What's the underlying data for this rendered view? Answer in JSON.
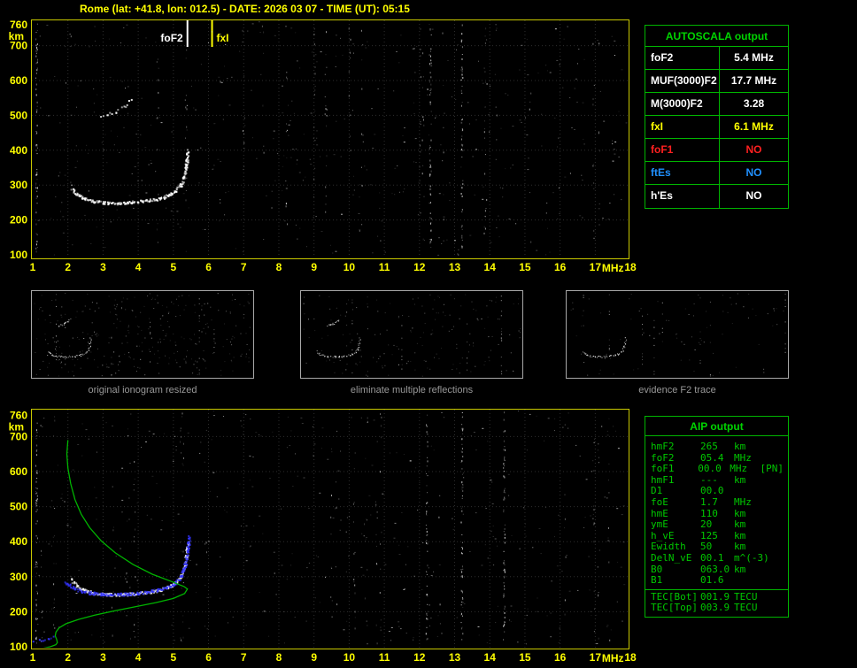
{
  "title": "Rome (lat: +41.8, lon: 012.5) - DATE: 2026 03 07 - TIME (UT): 05:15",
  "colors": {
    "background": "#000000",
    "title": "#ffff00",
    "plot_border": "#c8c800",
    "axis_label": "#ffff00",
    "grid": "#2e2e2e",
    "table_border": "#00b400",
    "aip_text": "#00c800",
    "caption": "#989898"
  },
  "autoscala": {
    "title": "AUTOSCALA output",
    "rows": [
      {
        "label": "foF2",
        "value": "5.4 MHz",
        "color": "#ffffff"
      },
      {
        "label": "MUF(3000)F2",
        "value": "17.7 MHz",
        "color": "#ffffff"
      },
      {
        "label": "M(3000)F2",
        "value": "3.28",
        "color": "#ffffff"
      },
      {
        "label": "fxI",
        "value": "6.1 MHz",
        "color": "#ffff00"
      },
      {
        "label": "foF1",
        "value": "NO",
        "color": "#ff2020"
      },
      {
        "label": "ftEs",
        "value": "NO",
        "color": "#2090ff"
      },
      {
        "label": "h'Es",
        "value": "NO",
        "color": "#ffffff"
      }
    ]
  },
  "thumbnails": [
    {
      "caption": "original ionogram resized"
    },
    {
      "caption": "eliminate multiple reflections"
    },
    {
      "caption": "evidence F2 trace"
    }
  ],
  "aip": {
    "title": "AIP output",
    "rows": [
      {
        "name": "hmF2",
        "value": "265",
        "unit": "km",
        "note": ""
      },
      {
        "name": "foF2",
        "value": "05.4",
        "unit": "MHz",
        "note": ""
      },
      {
        "name": "foF1",
        "value": "00.0",
        "unit": "MHz",
        "note": "[PN]"
      },
      {
        "name": "hmF1",
        "value": "---",
        "unit": "km",
        "note": ""
      },
      {
        "name": "D1",
        "value": "00.0",
        "unit": "",
        "note": ""
      },
      {
        "name": "foE",
        "value": "1.7",
        "unit": "MHz",
        "note": ""
      },
      {
        "name": "hmE",
        "value": "110",
        "unit": "km",
        "note": ""
      },
      {
        "name": "ymE",
        "value": "20",
        "unit": "km",
        "note": ""
      },
      {
        "name": "h_vE",
        "value": "125",
        "unit": "km",
        "note": ""
      },
      {
        "name": "Ewidth",
        "value": "50",
        "unit": "km",
        "note": ""
      },
      {
        "name": "DelN_vE",
        "value": "00.1",
        "unit": "m^(-3)",
        "note": ""
      },
      {
        "name": "B0",
        "value": "063.0",
        "unit": "km",
        "note": ""
      },
      {
        "name": "B1",
        "value": "01.6",
        "unit": "",
        "note": ""
      }
    ],
    "tec_rows": [
      {
        "name": "TEC[Bot]",
        "value": "001.9",
        "unit": "TECU"
      },
      {
        "name": "TEC[Top]",
        "value": "003.9",
        "unit": "TECU"
      }
    ]
  },
  "chart_data": [
    {
      "id": "top-ionogram",
      "type": "scatter",
      "title": "recorded ionogram with autoscaled characteristics",
      "xlabel": "MHz",
      "ylabel": "km",
      "xlim": [
        1,
        18
      ],
      "ylim": [
        90,
        775
      ],
      "xticks": [
        1,
        2,
        3,
        4,
        5,
        6,
        7,
        8,
        9,
        10,
        11,
        12,
        13,
        14,
        15,
        16,
        17,
        18
      ],
      "yticks": [
        100,
        200,
        300,
        400,
        500,
        600,
        700,
        760
      ],
      "grid": true,
      "markers": [
        {
          "label": "foF2",
          "x": 5.4,
          "color": "#ffffff",
          "side": "left"
        },
        {
          "label": "fxI",
          "x": 6.1,
          "color": "#ffff00",
          "side": "right"
        }
      ],
      "series": [
        {
          "name": "F2 echo trace",
          "color": "#ffffff",
          "points": [
            [
              2.1,
              292
            ],
            [
              2.25,
              275
            ],
            [
              2.45,
              262
            ],
            [
              2.7,
              255
            ],
            [
              3.0,
              251
            ],
            [
              3.4,
              250
            ],
            [
              3.8,
              252
            ],
            [
              4.2,
              256
            ],
            [
              4.6,
              263
            ],
            [
              4.85,
              272
            ],
            [
              5.05,
              285
            ],
            [
              5.2,
              302
            ],
            [
              5.3,
              328
            ],
            [
              5.36,
              360
            ],
            [
              5.4,
              400
            ]
          ]
        },
        {
          "name": "second-hop echo",
          "color": "#ffffff",
          "sparse": true,
          "points": [
            [
              2.9,
              498
            ],
            [
              3.1,
              503
            ],
            [
              3.35,
              512
            ],
            [
              3.6,
              528
            ],
            [
              3.8,
              548
            ]
          ]
        }
      ],
      "rfi_columns": [
        1.1,
        12.3,
        13.2
      ],
      "noise_dots": 430,
      "seed": 7
    },
    {
      "id": "bottom-ionogram",
      "type": "scatter",
      "title": "restored trace and electron density profile",
      "xlabel": "MHz",
      "ylabel": "km",
      "xlim": [
        1,
        18
      ],
      "ylim": [
        90,
        775
      ],
      "xticks": [
        1,
        2,
        3,
        4,
        5,
        6,
        7,
        8,
        9,
        10,
        11,
        12,
        13,
        14,
        15,
        16,
        17,
        18
      ],
      "yticks": [
        100,
        200,
        300,
        400,
        500,
        600,
        700,
        760
      ],
      "grid": true,
      "series": [
        {
          "name": "F2 echo trace",
          "color": "#ffffff",
          "points": [
            [
              2.1,
              292
            ],
            [
              2.25,
              275
            ],
            [
              2.45,
              262
            ],
            [
              2.7,
              255
            ],
            [
              3.0,
              251
            ],
            [
              3.4,
              250
            ],
            [
              3.8,
              252
            ],
            [
              4.2,
              256
            ],
            [
              4.6,
              263
            ],
            [
              4.85,
              272
            ],
            [
              5.05,
              285
            ],
            [
              5.2,
              302
            ],
            [
              5.3,
              328
            ],
            [
              5.36,
              360
            ],
            [
              5.4,
              400
            ]
          ]
        },
        {
          "name": "restored trace",
          "color": "#3333ff",
          "points": [
            [
              1.9,
              286
            ],
            [
              2.2,
              265
            ],
            [
              2.6,
              255
            ],
            [
              3.0,
              251
            ],
            [
              3.5,
              251
            ],
            [
              4.0,
              255
            ],
            [
              4.5,
              263
            ],
            [
              4.8,
              271
            ],
            [
              5.05,
              284
            ],
            [
              5.2,
              302
            ],
            [
              5.32,
              335
            ],
            [
              5.4,
              375
            ],
            [
              5.44,
              415
            ]
          ]
        },
        {
          "name": "E-region trace",
          "color": "#3333ff",
          "sparse": true,
          "points": [
            [
              1.02,
              118
            ],
            [
              1.25,
              121
            ],
            [
              1.45,
              124
            ],
            [
              1.6,
              128
            ]
          ]
        }
      ],
      "profile": {
        "name": "electron density profile N(h)",
        "color": "#00b400",
        "foF2": 5.4,
        "hmF2": 265,
        "foE": 1.7,
        "hmE": 110,
        "B0": 63.0,
        "B1": 1.6,
        "points": [
          [
            2.0,
            690
          ],
          [
            1.97,
            650
          ],
          [
            2.0,
            610
          ],
          [
            2.08,
            565
          ],
          [
            2.2,
            520
          ],
          [
            2.38,
            478
          ],
          [
            2.62,
            440
          ],
          [
            2.95,
            402
          ],
          [
            3.35,
            368
          ],
          [
            3.85,
            335
          ],
          [
            4.4,
            307
          ],
          [
            4.95,
            286
          ],
          [
            5.3,
            272
          ],
          [
            5.4,
            265
          ],
          [
            5.32,
            252
          ],
          [
            5.0,
            238
          ],
          [
            4.5,
            226
          ],
          [
            3.9,
            214
          ],
          [
            3.3,
            202
          ],
          [
            2.75,
            190
          ],
          [
            2.3,
            178
          ],
          [
            1.95,
            166
          ],
          [
            1.75,
            154
          ],
          [
            1.66,
            142
          ],
          [
            1.64,
            131
          ],
          [
            1.68,
            121
          ],
          [
            1.7,
            112
          ],
          [
            1.66,
            106
          ],
          [
            1.5,
            100
          ],
          [
            1.25,
            95
          ],
          [
            1.0,
            91
          ]
        ]
      },
      "rfi_columns": [
        1.1,
        12.2,
        13.2,
        14.4
      ],
      "noise_dots": 390,
      "seed": 13
    }
  ]
}
